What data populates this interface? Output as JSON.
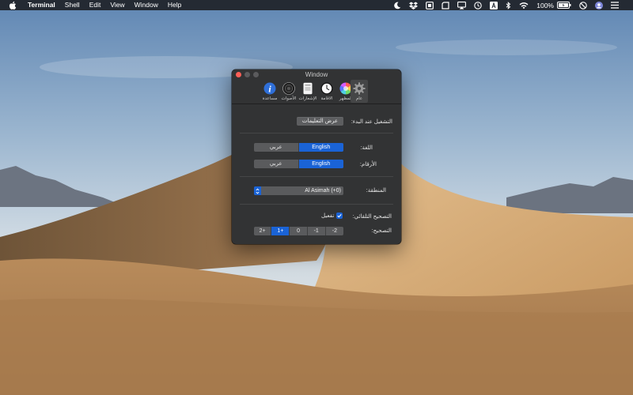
{
  "menubar": {
    "app_name": "Terminal",
    "menus": [
      "Shell",
      "Edit",
      "View",
      "Window",
      "Help"
    ],
    "battery_percent": "100%",
    "status_icons": [
      "moon-icon",
      "dropbox-icon",
      "box-icon",
      "rounded-square-icon",
      "airplay-icon",
      "time-machine-icon",
      "keyboard-input-icon",
      "bluetooth-icon",
      "wifi-icon",
      "battery-icon",
      "do-not-disturb-icon",
      "user-avatar-icon",
      "list-icon"
    ]
  },
  "window": {
    "title": "Window",
    "tabs": [
      {
        "label": "مساعدة",
        "icon": "info-icon"
      },
      {
        "label": "الأصوات",
        "icon": "speaker-icon"
      },
      {
        "label": "الإشعارات",
        "icon": "notification-icon"
      },
      {
        "label": "الاقامة",
        "icon": "clock-icon"
      },
      {
        "label": "المظهر",
        "icon": "color-wheel-icon"
      },
      {
        "label": "عام",
        "icon": "gear-icon"
      }
    ],
    "selected_tab": "عام",
    "startup": {
      "label": "التشغيل عند البدء:",
      "button": "عرض التعليمات"
    },
    "language": {
      "label": "اللغة:",
      "options": [
        "عربي",
        "English"
      ],
      "selected": "English"
    },
    "numerals": {
      "label": "الأرقام:",
      "options": [
        "عربي",
        "English"
      ],
      "selected": "English"
    },
    "region": {
      "label": "المنطقة:",
      "value": "Al Asimah (+0)"
    },
    "autocorrect": {
      "label": "التصحيح التلقائي:",
      "checkbox_label": "تفعيل",
      "checked": true
    },
    "correction": {
      "label": "التصحيح:",
      "options": [
        "2+",
        "1+",
        "0",
        "-1",
        "-2"
      ],
      "selected": "1+"
    }
  },
  "colors": {
    "accent": "#1a63d6",
    "window_bg": "#323334",
    "close_button": "#ff5f57",
    "menubar_bg": "#242a33"
  }
}
